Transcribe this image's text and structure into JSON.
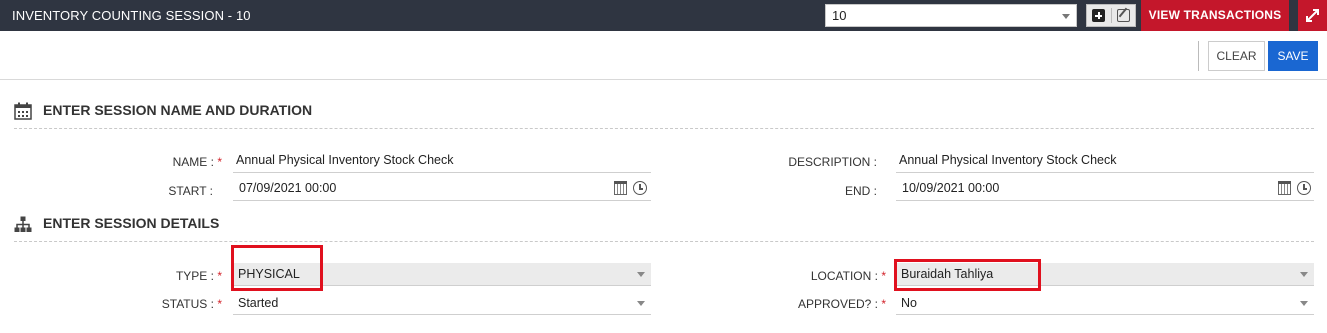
{
  "header": {
    "title": "INVENTORY COUNTING SESSION - 10",
    "session_select_value": "10",
    "view_transactions_label": "VIEW TRANSACTIONS"
  },
  "toolbar": {
    "clear_label": "CLEAR",
    "save_label": "SAVE"
  },
  "section1": {
    "heading": "ENTER SESSION NAME AND DURATION",
    "name_label": "NAME :",
    "name_value": "Annual Physical Inventory Stock Check",
    "description_label": "DESCRIPTION :",
    "description_value": "Annual Physical Inventory Stock Check",
    "start_label": "START :",
    "start_value": "07/09/2021 00:00",
    "end_label": "END :",
    "end_value": "10/09/2021 00:00"
  },
  "section2": {
    "heading": "ENTER SESSION DETAILS",
    "type_label": "TYPE :",
    "type_value": "PHYSICAL",
    "location_label": "LOCATION :",
    "location_value": "Buraidah Tahliya",
    "status_label": "STATUS :",
    "status_value": "Started",
    "approved_label": "APPROVED? :",
    "approved_value": "No"
  },
  "required_marker": "*",
  "colors": {
    "titlebar": "#2f3541",
    "accent_red": "#c4172b",
    "save_blue": "#1a67d2",
    "highlight_box": "#e0101e"
  }
}
